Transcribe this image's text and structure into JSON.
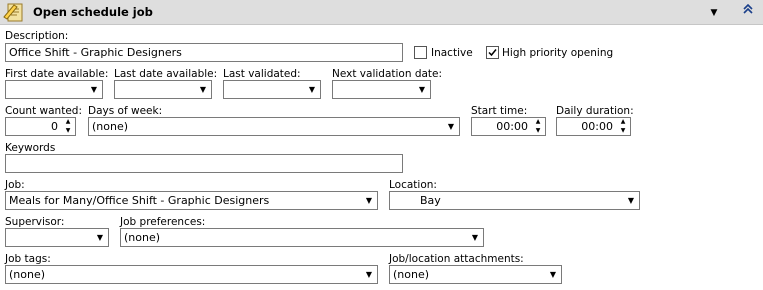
{
  "header": {
    "title": "Open schedule job",
    "icon": "schedule-job-icon"
  },
  "description": {
    "label": "Description:",
    "value": "Office Shift - Graphic Designers"
  },
  "inactive": {
    "label": "Inactive",
    "checked": false
  },
  "high_priority": {
    "label": "High priority opening",
    "checked": true
  },
  "first_date": {
    "label": "First date available:",
    "value": ""
  },
  "last_date": {
    "label": "Last date available:",
    "value": ""
  },
  "last_validated": {
    "label": "Last validated:",
    "value": ""
  },
  "next_validation": {
    "label": "Next validation date:",
    "value": ""
  },
  "count_wanted": {
    "label": "Count wanted:",
    "value": "0"
  },
  "days_of_week": {
    "label": "Days of week:",
    "value": "(none)"
  },
  "start_time": {
    "label": "Start time:",
    "value": "00:00"
  },
  "daily_duration": {
    "label": "Daily duration:",
    "value": "00:00"
  },
  "keywords": {
    "label": "Keywords",
    "value": ""
  },
  "job": {
    "label": "Job:",
    "value": "Meals for Many/Office Shift - Graphic Designers"
  },
  "location": {
    "label": "Location:",
    "value": "Bay"
  },
  "supervisor": {
    "label": "Supervisor:",
    "value": ""
  },
  "job_preferences": {
    "label": "Job preferences:",
    "value": "(none)"
  },
  "job_tags": {
    "label": "Job tags:",
    "value": "(none)"
  },
  "attachments": {
    "label": "Job/location attachments:",
    "value": "(none)"
  }
}
